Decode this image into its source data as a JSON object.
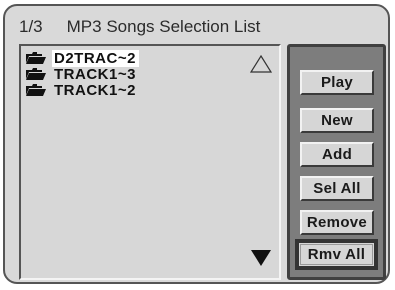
{
  "header": {
    "page_indicator": "1/3",
    "title": "MP3 Songs Selection List"
  },
  "file_list": {
    "items": [
      {
        "label": "D2TRAC~2",
        "icon": "folder-icon",
        "selected": true
      },
      {
        "label": "TRACK1~3",
        "icon": "folder-icon",
        "selected": false
      },
      {
        "label": "TRACK1~2",
        "icon": "folder-icon",
        "selected": false
      }
    ],
    "scroll_up_icon": "triangle-up-outline-icon",
    "scroll_down_icon": "triangle-down-filled-icon"
  },
  "buttons": {
    "play": "Play",
    "new": "New",
    "add": "Add",
    "sel_all": "Sel All",
    "remove": "Remove",
    "rmv_all": "Rmv All",
    "focused": "rmv_all"
  },
  "colors": {
    "background": "#d9d9d9",
    "button_panel": "#7d7d7d",
    "selected_highlight": "#ffffff"
  }
}
